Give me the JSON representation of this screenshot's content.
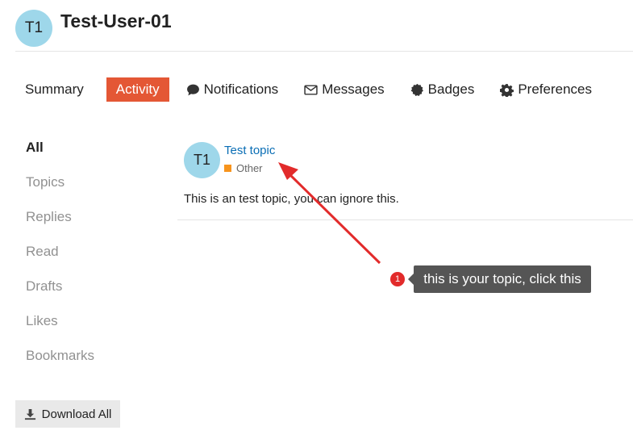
{
  "user": {
    "initials": "T1",
    "name": "Test-User-01"
  },
  "nav": [
    {
      "label": "Summary",
      "icon": "",
      "active": false
    },
    {
      "label": "Activity",
      "icon": "",
      "active": true
    },
    {
      "label": "Notifications",
      "icon": "comment-icon",
      "active": false
    },
    {
      "label": "Messages",
      "icon": "envelope-icon",
      "active": false
    },
    {
      "label": "Badges",
      "icon": "badge-icon",
      "active": false
    },
    {
      "label": "Preferences",
      "icon": "gear-icon",
      "active": false
    }
  ],
  "sidebar": [
    {
      "label": "All",
      "active": true
    },
    {
      "label": "Topics",
      "active": false
    },
    {
      "label": "Replies",
      "active": false
    },
    {
      "label": "Read",
      "active": false
    },
    {
      "label": "Drafts",
      "active": false
    },
    {
      "label": "Likes",
      "active": false
    },
    {
      "label": "Bookmarks",
      "active": false
    }
  ],
  "download": {
    "label": "Download All",
    "icon": "download-icon"
  },
  "post": {
    "avatar": "T1",
    "title": "Test topic",
    "category": "Other",
    "category_color": "#f7941d",
    "excerpt": "This is an test topic, you can ignore this."
  },
  "annotation": {
    "step": "1",
    "text": "this is your topic, click this",
    "arrow_color": "#e22b2b"
  },
  "colors": {
    "accent": "#e45735",
    "link": "#0a6eb5",
    "avatar_bg": "#9ed7ea"
  }
}
